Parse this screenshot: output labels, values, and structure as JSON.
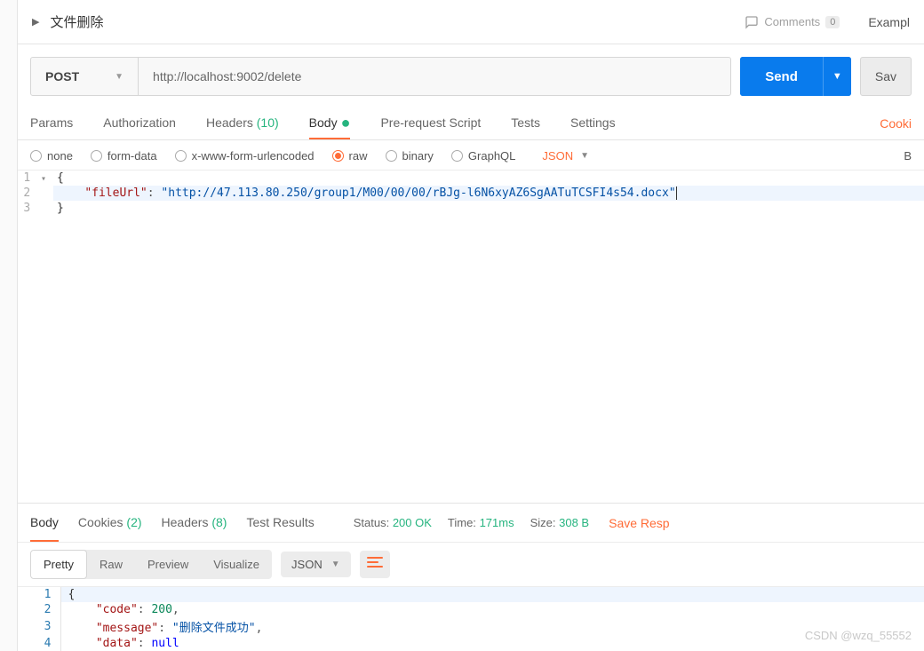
{
  "header": {
    "tab_title": "文件删除",
    "comments_label": "Comments",
    "comments_count": "0",
    "examples_label": "Exampl"
  },
  "request": {
    "method": "POST",
    "url": "http://localhost:9002/delete",
    "send_label": "Send",
    "save_label": "Sav"
  },
  "tabs": {
    "params": "Params",
    "authorization": "Authorization",
    "headers": "Headers",
    "headers_count": "(10)",
    "body": "Body",
    "prerequest": "Pre-request Script",
    "tests": "Tests",
    "settings": "Settings",
    "cookies": "Cooki"
  },
  "body_types": {
    "none": "none",
    "formdata": "form-data",
    "urlencoded": "x-www-form-urlencoded",
    "raw": "raw",
    "binary": "binary",
    "graphql": "GraphQL",
    "raw_type": "JSON",
    "beautify": "B"
  },
  "req_editor": {
    "l1": "{",
    "l2_key": "\"fileUrl\"",
    "l2_sep": ": ",
    "l2_val": "\"http://47.113.80.250/group1/M00/00/00/rBJg-l6N6xyAZ6SgAATuTCSFI4s54.docx\"",
    "l3": "}"
  },
  "resp_tabs": {
    "body": "Body",
    "cookies": "Cookies",
    "cookies_count": "(2)",
    "headers": "Headers",
    "headers_count": "(8)",
    "tests": "Test Results"
  },
  "resp_meta": {
    "status_label": "Status:",
    "status_value": "200 OK",
    "time_label": "Time:",
    "time_value": "171ms",
    "size_label": "Size:",
    "size_value": "308 B",
    "save_label": "Save Resp"
  },
  "view": {
    "pretty": "Pretty",
    "raw": "Raw",
    "preview": "Preview",
    "visualize": "Visualize",
    "format": "JSON"
  },
  "resp_editor": {
    "l1": "{",
    "l2_k": "\"code\"",
    "l2_s": ": ",
    "l2_v": "200",
    "l2_c": ",",
    "l3_k": "\"message\"",
    "l3_s": ": ",
    "l3_v": "\"删除文件成功\"",
    "l3_c": ",",
    "l4_k": "\"data\"",
    "l4_s": ": ",
    "l4_v": "null"
  },
  "watermark": "CSDN @wzq_55552"
}
